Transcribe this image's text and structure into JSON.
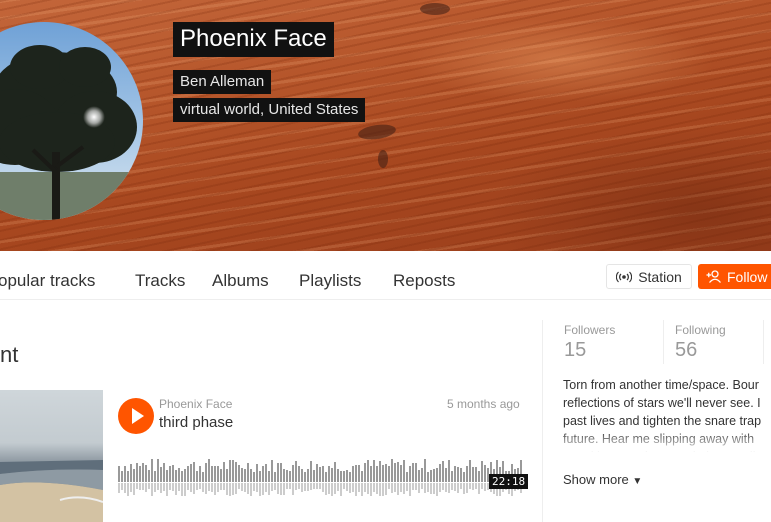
{
  "profile": {
    "display_name": "Phoenix Face",
    "username": "Ben Alleman",
    "location": "virtual world, United States"
  },
  "nav": {
    "tabs": [
      "opular tracks",
      "Tracks",
      "Albums",
      "Playlists",
      "Reposts"
    ],
    "station_label": "Station",
    "follow_label": "Follow"
  },
  "section_title": "nt",
  "track": {
    "artist": "Phoenix Face",
    "title": "third phase",
    "posted_ago": "5 months ago",
    "duration": "22:18"
  },
  "stats": {
    "followers_label": "Followers",
    "followers_value": "15",
    "following_label": "Following",
    "following_value": "56"
  },
  "bio": "Torn from another time/space. Bour\nreflections of stars we'll never see. I\npast lives and tighten the snare trap\nfuture. Hear me slipping away with\nstand into starting over in hopes cli",
  "show_more_label": "Show more",
  "colors": {
    "accent": "#ff5500",
    "banner_wood": "#b5552a"
  },
  "icons": [
    "station-icon",
    "follow-user-icon",
    "play-icon",
    "caret-down-icon"
  ]
}
